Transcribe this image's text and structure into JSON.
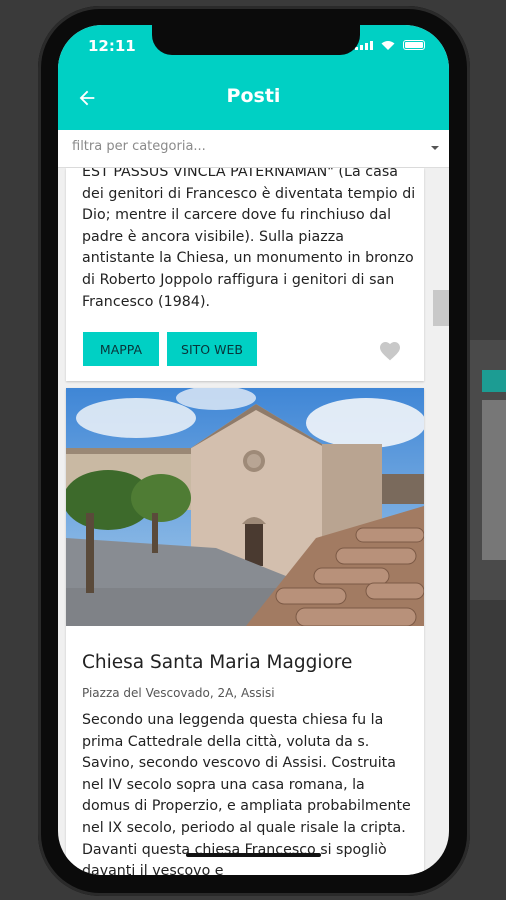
{
  "status_bar": {
    "time": "12:11"
  },
  "app_bar": {
    "title": "Posti"
  },
  "filter": {
    "placeholder": "filtra per categoria..."
  },
  "cards": [
    {
      "description": "EST PASSUS VINCLA PATERNAMAN\" (La casa dei genitori di Francesco è diventata tempio di Dio; mentre il carcere dove fu rinchiuso dal padre è ancora visibile). Sulla piazza antistante la Chiesa, un monumento in bronzo di Roberto Joppolo raffigura i genitori di san Francesco (1984).",
      "map_label": "MAPPA",
      "web_label": "SITO WEB"
    },
    {
      "title": "Chiesa Santa Maria Maggiore",
      "address": "Piazza del Vescovado, 2A, Assisi",
      "description": "Secondo una leggenda questa chiesa fu la prima Cattedrale della città, voluta da s. Savino, secondo vescovo di Assisi. Costruita nel IV secolo sopra una casa romana, la domus di Properzio, e ampliata probabilmente nel IX secolo, periodo al quale risale la cripta. Davanti questa chiesa Francesco si spogliò davanti il vescovo e"
    }
  ],
  "colors": {
    "accent": "#00d0c4",
    "background": "#f0f0f0"
  },
  "icons": [
    "back-arrow-icon",
    "heart-icon",
    "dropdown-caret-icon",
    "signal-icon",
    "wifi-icon",
    "battery-icon"
  ]
}
